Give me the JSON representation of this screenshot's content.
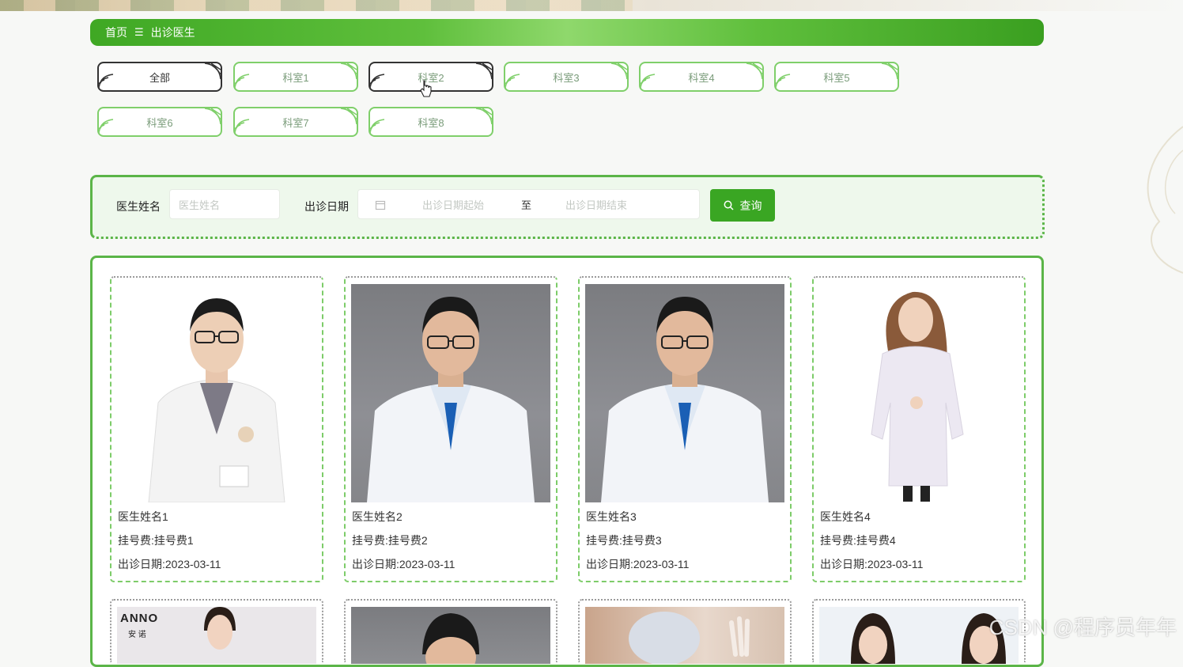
{
  "breadcrumb": {
    "home": "首页",
    "separator": "☰",
    "current": "出诊医生"
  },
  "categories": [
    "全部",
    "科室1",
    "科室2",
    "科室3",
    "科室4",
    "科室5",
    "科室6",
    "科室7",
    "科室8"
  ],
  "search": {
    "name_label": "医生姓名",
    "name_placeholder": "医生姓名",
    "date_label": "出诊日期",
    "date_start_placeholder": "出诊日期起始",
    "date_to": "至",
    "date_end_placeholder": "出诊日期结束",
    "query_button": "查询"
  },
  "doctors": [
    {
      "name": "医生姓名1",
      "fee": "挂号费:挂号费1",
      "date": "出诊日期:2023-03-11"
    },
    {
      "name": "医生姓名2",
      "fee": "挂号费:挂号费2",
      "date": "出诊日期:2023-03-11"
    },
    {
      "name": "医生姓名3",
      "fee": "挂号费:挂号费3",
      "date": "出诊日期:2023-03-11"
    },
    {
      "name": "医生姓名4",
      "fee": "挂号费:挂号费4",
      "date": "出诊日期:2023-03-11"
    }
  ],
  "second_row_logo": {
    "line1": "ANNO",
    "line2": "安 诺"
  },
  "watermark": "CSDN @程序员年年",
  "colors": {
    "accent": "#3aa623",
    "border": "#5bb548",
    "panel_bg": "#eef8ec"
  }
}
